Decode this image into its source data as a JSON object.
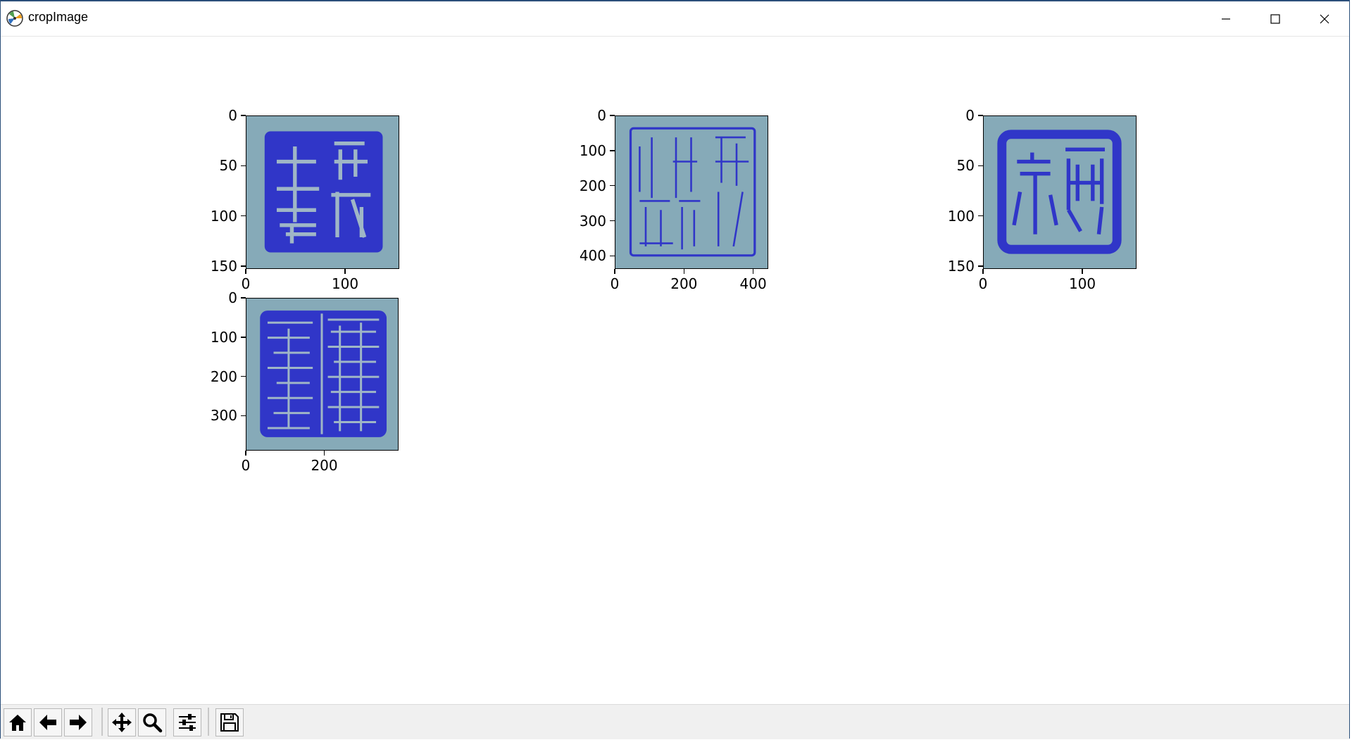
{
  "window": {
    "title": "cropImage"
  },
  "figure": {
    "subplots": [
      {
        "name": "seal-1",
        "image_desc": "blue square seal",
        "y_ticks": [
          "0",
          "50",
          "100",
          "150"
        ],
        "x_ticks": [
          "0",
          "100"
        ]
      },
      {
        "name": "seal-2",
        "image_desc": "blue square seal with thin characters",
        "y_ticks": [
          "0",
          "100",
          "200",
          "300",
          "400"
        ],
        "x_ticks": [
          "0",
          "200",
          "400"
        ]
      },
      {
        "name": "seal-3",
        "image_desc": "blue square seal with thick border",
        "y_ticks": [
          "0",
          "50",
          "100",
          "150"
        ],
        "x_ticks": [
          "0",
          "100"
        ]
      },
      {
        "name": "seal-4",
        "image_desc": "blue square seal dense characters",
        "y_ticks": [
          "0",
          "100",
          "200",
          "300"
        ],
        "x_ticks": [
          "0",
          "200"
        ]
      }
    ]
  },
  "toolbar": {
    "buttons": [
      {
        "name": "home-button",
        "icon": "home-icon"
      },
      {
        "name": "back-button",
        "icon": "arrow-left-icon"
      },
      {
        "name": "forward-button",
        "icon": "arrow-right-icon"
      },
      {
        "name": "pan-button",
        "icon": "move-icon"
      },
      {
        "name": "zoom-button",
        "icon": "magnifier-icon"
      },
      {
        "name": "configure-subplots-button",
        "icon": "sliders-icon"
      },
      {
        "name": "save-button",
        "icon": "floppy-disk-icon"
      }
    ]
  },
  "colors": {
    "seal_ink": "#3036c8",
    "seal_paper": "#86aab8"
  }
}
